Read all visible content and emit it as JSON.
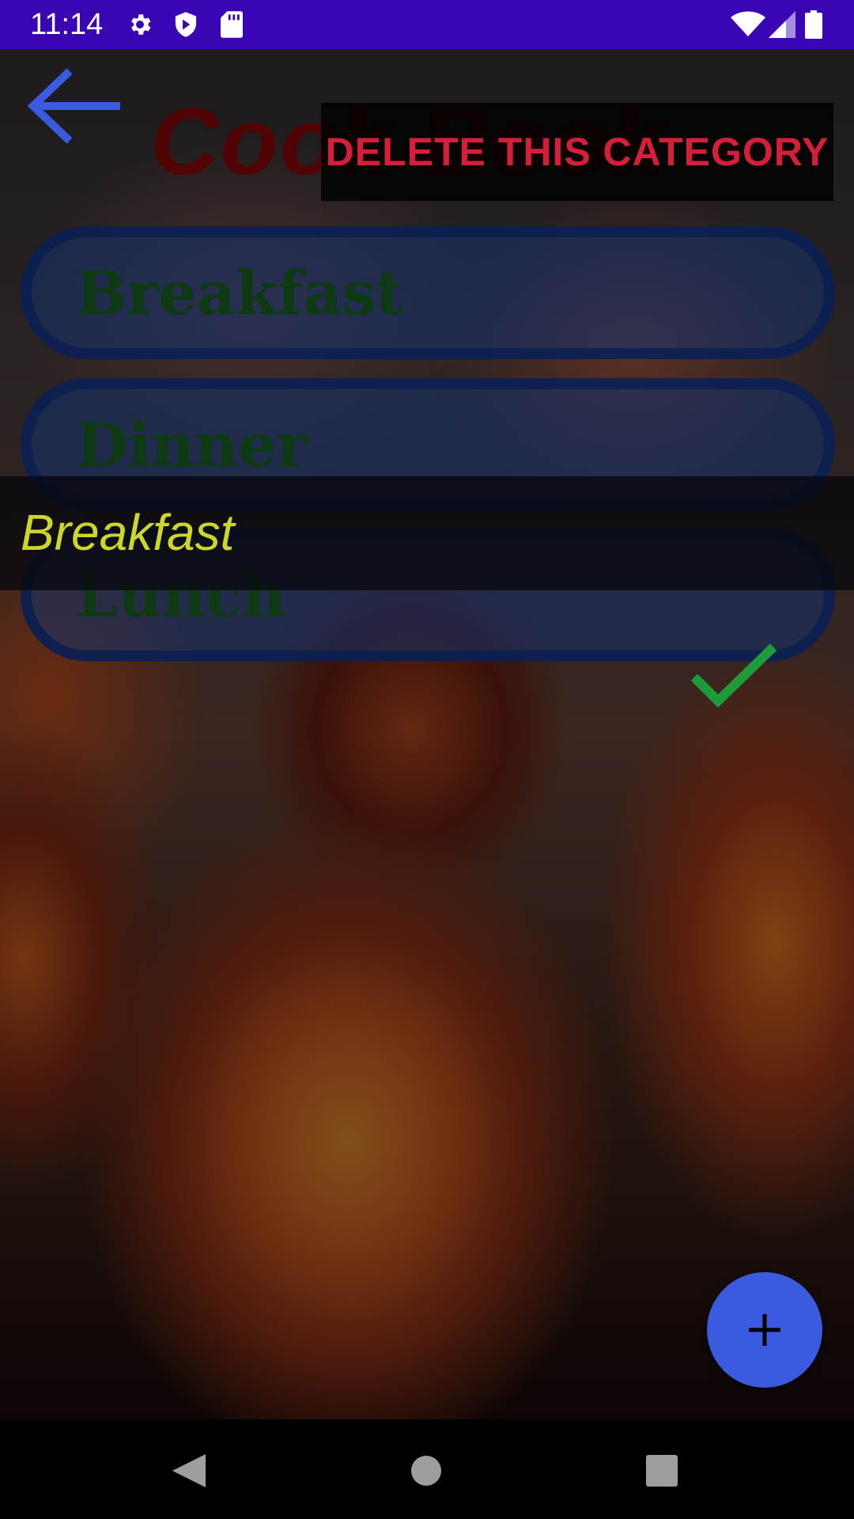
{
  "status_bar": {
    "time": "11:14",
    "icons": [
      "gear-icon",
      "shield-icon",
      "sd-card-icon",
      "wifi-icon",
      "signal-icon",
      "battery-icon"
    ],
    "background": "#3a06b5"
  },
  "header": {
    "title": "Cook Book",
    "back_icon": "arrow-left-icon",
    "delete_label": "DELETE THIS CATEGORY"
  },
  "categories": [
    {
      "label": "Breakfast"
    },
    {
      "label": "Dinner"
    },
    {
      "label": "Lunch"
    }
  ],
  "edit": {
    "value": "Breakfast",
    "confirm_icon": "check-icon"
  },
  "fab": {
    "icon": "plus-icon"
  },
  "nav": {
    "icons": [
      "back-triangle-icon",
      "home-circle-icon",
      "recents-square-icon"
    ]
  },
  "colors": {
    "accent": "#3a5ae0",
    "delete_text": "#d41e3a",
    "edit_text": "#cdd629",
    "check": "#1f9a3a"
  }
}
